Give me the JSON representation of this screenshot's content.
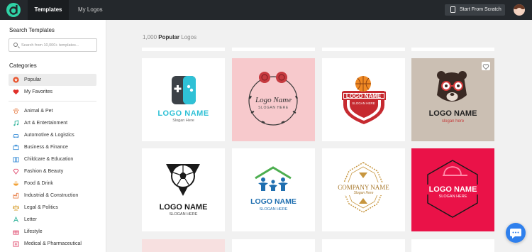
{
  "header": {
    "nav": [
      "Templates",
      "My Logos"
    ],
    "scratch_button": "Start From Scratch",
    "brand_color": "#2fd3a6"
  },
  "sidebar": {
    "search_title": "Search Templates",
    "search_placeholder": "Search from 10,000+ templates...",
    "categories_title": "Categories",
    "items": [
      {
        "label": "Popular",
        "icon": "star-icon"
      },
      {
        "label": "My Favorites",
        "icon": "heart-icon"
      },
      {
        "label": "Animal & Pet",
        "icon": "paw-icon"
      },
      {
        "label": "Art & Entertainment",
        "icon": "music-note-icon"
      },
      {
        "label": "Automotive & Logistics",
        "icon": "car-icon"
      },
      {
        "label": "Business & Finance",
        "icon": "briefcase-icon"
      },
      {
        "label": "Childcare & Education",
        "icon": "book-icon"
      },
      {
        "label": "Fashion & Beauty",
        "icon": "diamond-icon"
      },
      {
        "label": "Food & Drink",
        "icon": "food-icon"
      },
      {
        "label": "Industrial & Construction",
        "icon": "factory-icon"
      },
      {
        "label": "Legal & Politics",
        "icon": "scale-icon"
      },
      {
        "label": "Letter",
        "icon": "letter-icon"
      },
      {
        "label": "Lifestyle",
        "icon": "gift-icon"
      },
      {
        "label": "Medical & Pharmaceutical",
        "icon": "medical-icon"
      }
    ]
  },
  "main": {
    "count": "1,000",
    "sort": "Popular",
    "suffix": "Logos",
    "tiles": [
      {
        "name": "LOGO NAME",
        "slogan": "Slogan Here",
        "icon": "gamepad-icon"
      },
      {
        "name": "Logo Name",
        "slogan": "SLOGAN HERE",
        "icon": "rose-wreath-icon"
      },
      {
        "name": "LOGO NAME",
        "slogan": "SLOGAN HERE",
        "icon": "basketball-shield-icon"
      },
      {
        "name": "LOGO NAME",
        "slogan": "slogan here",
        "icon": "bear-icon"
      },
      {
        "name": "LOGO NAME",
        "slogan": "SLOGAN HERE",
        "icon": "soccer-ball-icon"
      },
      {
        "name": "LOGO NAME",
        "slogan": "SLOGAN HERE",
        "icon": "family-house-icon"
      },
      {
        "name": "COMPANY NAME",
        "slogan": "Slogan Here",
        "icon": "ornament-icon"
      },
      {
        "name": "LOGO NAME",
        "slogan": "SLOGAN HERE",
        "icon": "cap-hexagon-icon"
      }
    ]
  }
}
